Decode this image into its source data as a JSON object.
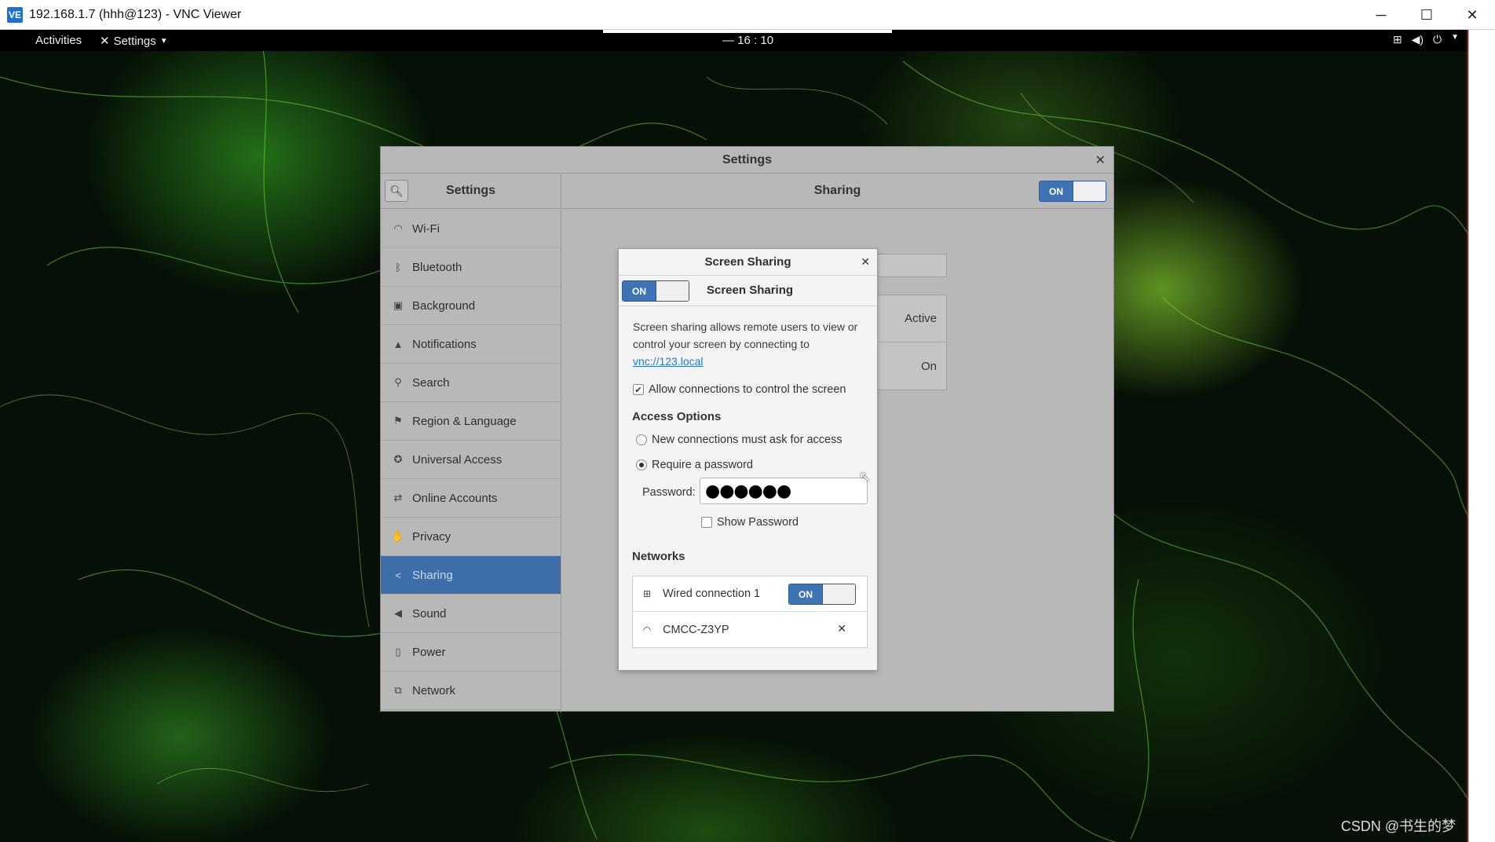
{
  "vnc": {
    "title": "192.168.1.7 (hhh@123) - VNC Viewer",
    "logo": "VE",
    "controls": {
      "minimize": "─",
      "maximize": "☐",
      "close": "✕"
    }
  },
  "topbar": {
    "activities": "Activities",
    "app_menu": "Settings",
    "clock": "16 : 10",
    "clock_prefix": "—"
  },
  "settings": {
    "window_title": "Settings",
    "sidebar_title": "Settings",
    "panel_title": "Sharing",
    "master_switch": "ON",
    "sidebar_items": [
      {
        "label": "Wi-Fi",
        "icon": "wifi-icon"
      },
      {
        "label": "Bluetooth",
        "icon": "bluetooth-icon"
      },
      {
        "label": "Background",
        "icon": "background-icon"
      },
      {
        "label": "Notifications",
        "icon": "bell-icon"
      },
      {
        "label": "Search",
        "icon": "search-icon"
      },
      {
        "label": "Region & Language",
        "icon": "flag-icon"
      },
      {
        "label": "Universal Access",
        "icon": "accessibility-icon"
      },
      {
        "label": "Online Accounts",
        "icon": "online-accounts-icon"
      },
      {
        "label": "Privacy",
        "icon": "hand-icon"
      },
      {
        "label": "Sharing",
        "icon": "share-icon"
      },
      {
        "label": "Sound",
        "icon": "speaker-icon"
      },
      {
        "label": "Power",
        "icon": "power-icon"
      },
      {
        "label": "Network",
        "icon": "network-icon"
      }
    ],
    "active_item": "Sharing",
    "background_rows": [
      "Active",
      "On"
    ]
  },
  "dialog": {
    "title": "Screen Sharing",
    "switch_state": "ON",
    "switch_label": "Screen Sharing",
    "description": "Screen sharing allows remote users to view or control your screen by connecting to ",
    "link": "vnc://123.local",
    "allow_control_label": "Allow connections to control the screen",
    "allow_control_checked": true,
    "access_heading": "Access Options",
    "option_ask": "New connections must ask for access",
    "option_password": "Require a password",
    "selected_option": "password",
    "password_label": "Password:",
    "password_value": "●●●●●●",
    "show_password_label": "Show Password",
    "show_password_checked": false,
    "networks_heading": "Networks",
    "networks": [
      {
        "name": "Wired connection 1",
        "state": "ON",
        "icon": "wired-network-icon"
      },
      {
        "name": "CMCC-Z3YP",
        "state": "",
        "icon": "wifi-icon"
      }
    ]
  },
  "watermark": "CSDN @书生的梦"
}
